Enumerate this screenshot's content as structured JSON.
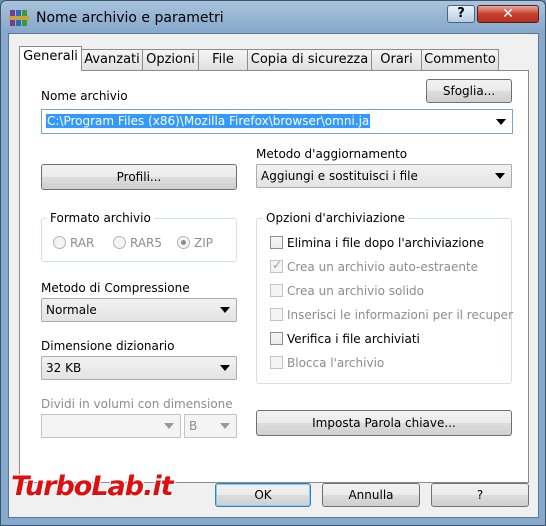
{
  "window": {
    "title": "Nome archivio e parametri",
    "help": "?",
    "close": "✕"
  },
  "tabs": [
    "Generali",
    "Avanzati",
    "Opzioni",
    "File",
    "Copia di sicurezza",
    "Orari",
    "Commento"
  ],
  "archive_name": {
    "label": "Nome archivio",
    "value": "C:\\Program Files (x86)\\Mozilla Firefox\\browser\\omni.ja",
    "browse": "Sfoglia..."
  },
  "profiles": {
    "label": "Profili..."
  },
  "update_method": {
    "label": "Metodo d'aggiornamento",
    "value": "Aggiungi e sostituisci i file"
  },
  "format": {
    "label": "Formato archivio",
    "options": [
      "RAR",
      "RAR5",
      "ZIP"
    ],
    "selected": "ZIP"
  },
  "compression": {
    "label": "Metodo di Compressione",
    "value": "Normale"
  },
  "dictionary": {
    "label": "Dimensione dizionario",
    "value": "32 KB"
  },
  "split": {
    "label": "Dividi in volumi con dimensione",
    "value": "",
    "unit": "B"
  },
  "archive_options": {
    "label": "Opzioni d'archiviazione",
    "items": [
      {
        "label": "Elimina i file dopo l'archiviazione",
        "checked": false,
        "enabled": true
      },
      {
        "label": "Crea un archivio auto-estraente",
        "checked": true,
        "enabled": false
      },
      {
        "label": "Crea un archivio solido",
        "checked": false,
        "enabled": false
      },
      {
        "label": "Inserisci le informazioni per il recuper",
        "checked": false,
        "enabled": false
      },
      {
        "label": "Verifica i file archiviati",
        "checked": false,
        "enabled": true
      },
      {
        "label": "Blocca l'archivio",
        "checked": false,
        "enabled": false
      }
    ]
  },
  "password_button": "Imposta Parola chiave...",
  "footer": {
    "ok": "OK",
    "cancel": "Annulla",
    "help": "?"
  },
  "watermark": "TurboLab.it"
}
